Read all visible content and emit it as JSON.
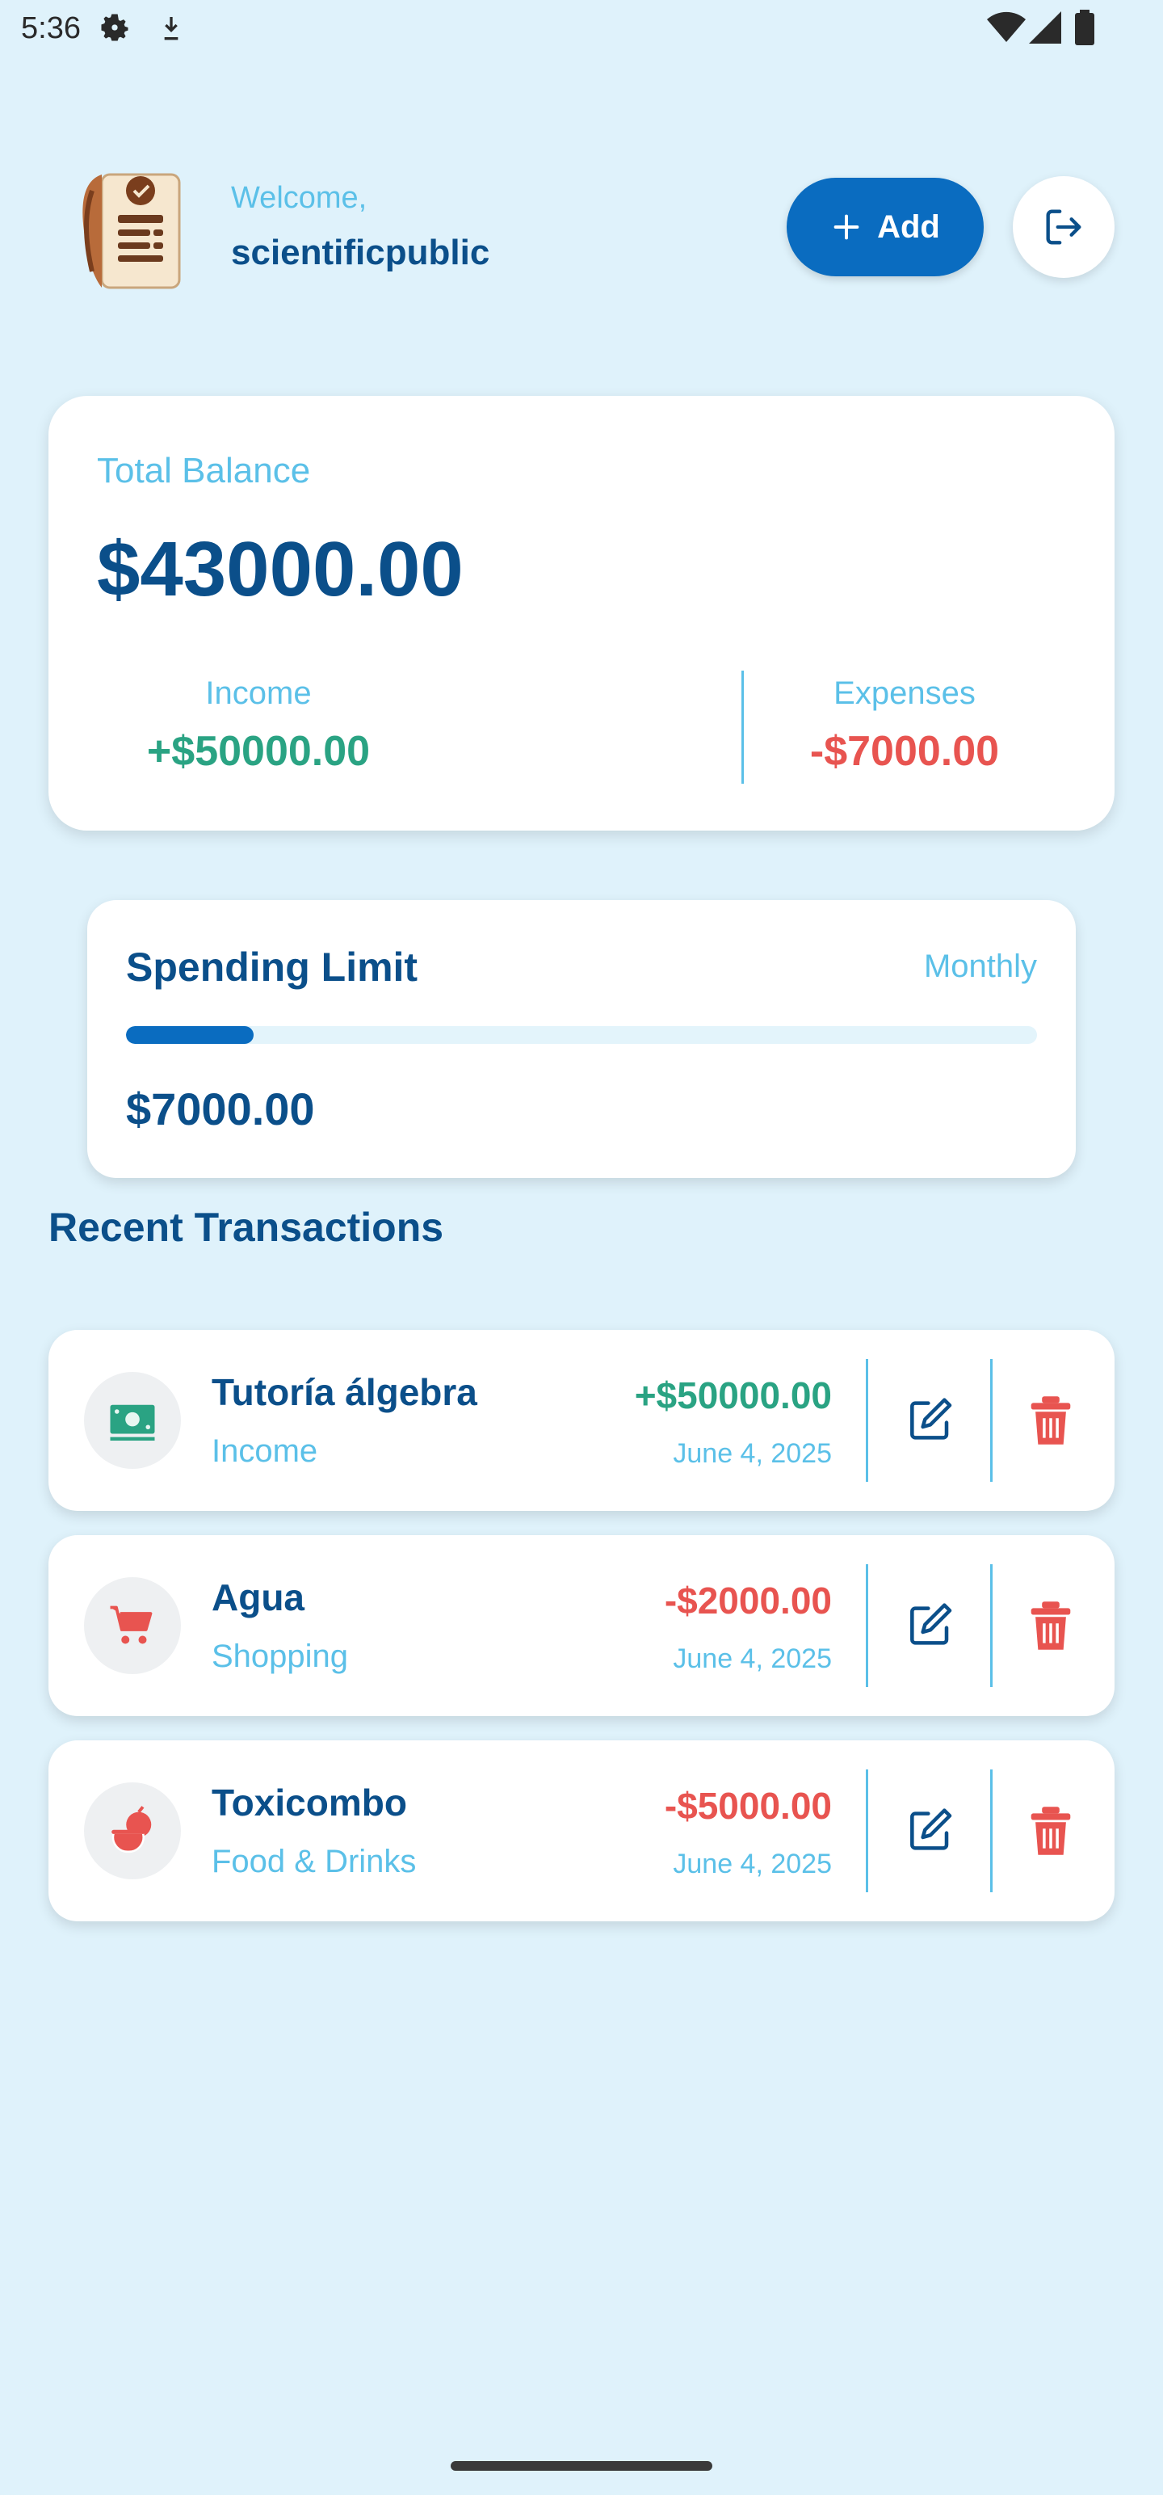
{
  "status_bar": {
    "time": "5:36"
  },
  "header": {
    "welcome": "Welcome,",
    "username": "scientificpublic",
    "add_label": "Add"
  },
  "balance": {
    "label": "Total Balance",
    "value": "$43000.00",
    "income_label": "Income",
    "income_value": "+$50000.00",
    "expenses_label": "Expenses",
    "expenses_value": "-$7000.00"
  },
  "spending_limit": {
    "title": "Spending Limit",
    "period": "Monthly",
    "value": "$7000.00",
    "progress_fraction": 0.14
  },
  "recent": {
    "title": "Recent Transactions",
    "items": [
      {
        "title": "Tutoría álgebra",
        "category": "Income",
        "amount": "+$50000.00",
        "date": "June 4, 2025",
        "type": "income",
        "icon": "money-icon"
      },
      {
        "title": "Agua",
        "category": "Shopping",
        "amount": "-$2000.00",
        "date": "June 4, 2025",
        "type": "expense",
        "icon": "cart-icon"
      },
      {
        "title": "Toxicombo",
        "category": "Food & Drinks",
        "amount": "-$5000.00",
        "date": "June 4, 2025",
        "type": "expense",
        "icon": "food-icon"
      }
    ]
  },
  "colors": {
    "background": "#dff2fb",
    "primary": "#0a6cc0",
    "heading": "#0b4f8a",
    "muted": "#5bc0e8",
    "income": "#2aa383",
    "expense": "#e85450"
  }
}
